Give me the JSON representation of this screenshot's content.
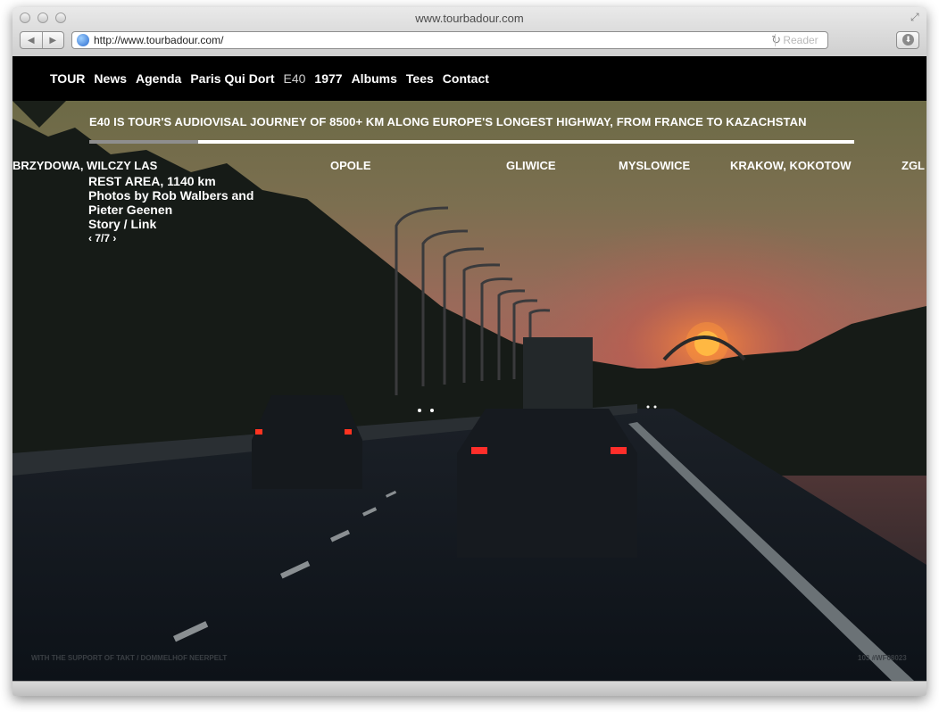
{
  "browser": {
    "window_title": "www.tourbadour.com",
    "url": "http://www.tourbadour.com/",
    "reader_label": "Reader"
  },
  "nav": {
    "items": [
      {
        "label": "TOUR"
      },
      {
        "label": "News"
      },
      {
        "label": "Agenda"
      },
      {
        "label": "Paris Qui Dort"
      },
      {
        "label": "E40"
      },
      {
        "label": "1977"
      },
      {
        "label": "Albums"
      },
      {
        "label": "Tees"
      },
      {
        "label": "Contact"
      }
    ],
    "active": "E40"
  },
  "e40": {
    "headline": "E40 IS TOUR'S AUDIOVISAL JOURNEY OF 8500+ KM ALONG EUROPE'S LONGEST HIGHWAY, FROM FRANCE TO KAZACHSTAN",
    "progress_fraction": 0.142,
    "places": [
      "BRZYDOWA, WILCZY LAS",
      "OPOLE",
      "GLIWICE",
      "MYSLOWICE",
      "KRAKOW, KOKOTOW",
      "ZGL"
    ],
    "caption": {
      "title": "REST AREA, 1140 km",
      "credit": "Photos by Rob Walbers and Pieter Geenen",
      "links": "Story / Link",
      "pager": "‹ 7/7 ›"
    },
    "footer_left": "WITH THE SUPPORT OF TAKT / DOMMELHOF NEERPELT",
    "footer_right": "103 #WF08023"
  }
}
